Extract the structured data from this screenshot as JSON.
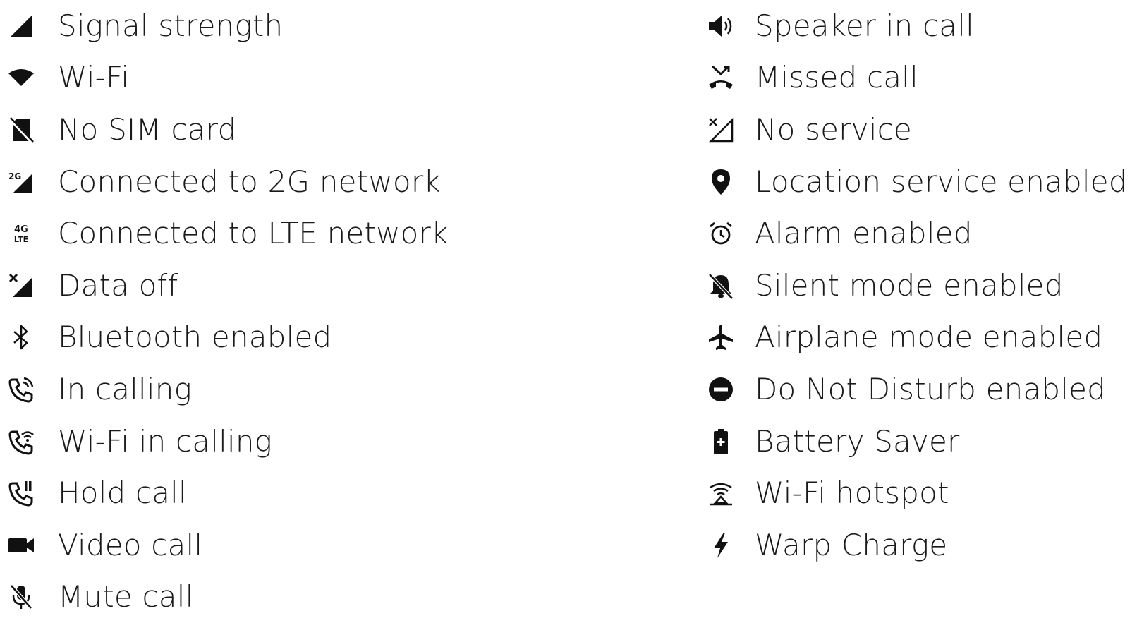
{
  "left_column": [
    {
      "icon": "signal-strength-icon",
      "label": "Signal strength"
    },
    {
      "icon": "wifi-icon",
      "label": "Wi-Fi"
    },
    {
      "icon": "no-sim-card-icon",
      "label": "No SIM card"
    },
    {
      "icon": "2g-network-icon",
      "label": "Connected to 2G network",
      "icon_text": "2G"
    },
    {
      "icon": "lte-network-icon",
      "label": "Connected to LTE network",
      "icon_text_top": "4G",
      "icon_text_bottom": "LTE"
    },
    {
      "icon": "data-off-icon",
      "label": "Data off"
    },
    {
      "icon": "bluetooth-icon",
      "label": "Bluetooth enabled"
    },
    {
      "icon": "in-call-icon",
      "label": "In calling"
    },
    {
      "icon": "wifi-call-icon",
      "label": "Wi-Fi in calling"
    },
    {
      "icon": "hold-call-icon",
      "label": "Hold call"
    },
    {
      "icon": "video-call-icon",
      "label": "Video call"
    },
    {
      "icon": "mute-call-icon",
      "label": "Mute call"
    }
  ],
  "right_column": [
    {
      "icon": "speaker-icon",
      "label": "Speaker in call"
    },
    {
      "icon": "missed-call-icon",
      "label": "Missed call"
    },
    {
      "icon": "no-service-icon",
      "label": "No service"
    },
    {
      "icon": "location-icon",
      "label": "Location service enabled"
    },
    {
      "icon": "alarm-icon",
      "label": "Alarm enabled"
    },
    {
      "icon": "silent-mode-icon",
      "label": "Silent mode enabled"
    },
    {
      "icon": "airplane-icon",
      "label": "Airplane mode enabled"
    },
    {
      "icon": "do-not-disturb-icon",
      "label": "Do Not Disturb enabled"
    },
    {
      "icon": "battery-saver-icon",
      "label": "Battery Saver"
    },
    {
      "icon": "wifi-hotspot-icon",
      "label": "Wi-Fi hotspot"
    },
    {
      "icon": "warp-charge-icon",
      "label": "Warp Charge"
    }
  ],
  "colors": {
    "icon": "#111111",
    "text": "#1a1a1a",
    "background": "#ffffff"
  }
}
